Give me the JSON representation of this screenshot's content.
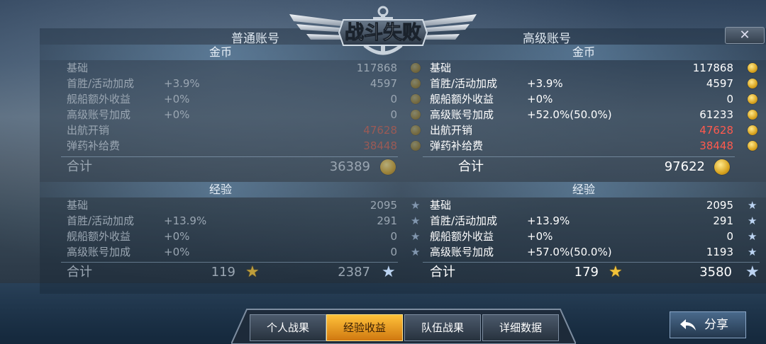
{
  "banner": {
    "title": "战斗失败"
  },
  "close_label": "✕",
  "normal": {
    "title": "普通账号",
    "gold": {
      "header": "金币",
      "rows": [
        {
          "label": "基础",
          "pct": "",
          "value": "117868"
        },
        {
          "label": "首胜/活动加成",
          "pct": "+3.9%",
          "value": "4597"
        },
        {
          "label": "舰船额外收益",
          "pct": "+0%",
          "value": "0"
        },
        {
          "label": "高级账号加成",
          "pct": "+0%",
          "value": "0"
        },
        {
          "label": "出航开销",
          "pct": "",
          "value": "47628"
        },
        {
          "label": "弹药补给费",
          "pct": "",
          "value": "38448"
        }
      ],
      "total_label": "合计",
      "total": "36389"
    },
    "exp": {
      "header": "经验",
      "rows": [
        {
          "label": "基础",
          "pct": "",
          "value": "2095"
        },
        {
          "label": "首胜/活动加成",
          "pct": "+13.9%",
          "value": "291"
        },
        {
          "label": "舰船额外收益",
          "pct": "+0%",
          "value": "0"
        },
        {
          "label": "高级账号加成",
          "pct": "+0%",
          "value": "0"
        }
      ],
      "total_label": "合计",
      "captain": "119",
      "total": "2387"
    }
  },
  "premium": {
    "title": "高级账号",
    "gold": {
      "header": "金币",
      "rows": [
        {
          "label": "基础",
          "pct": "",
          "value": "117868"
        },
        {
          "label": "首胜/活动加成",
          "pct": "+3.9%",
          "value": "4597"
        },
        {
          "label": "舰船额外收益",
          "pct": "+0%",
          "value": "0"
        },
        {
          "label": "高级账号加成",
          "pct": "+52.0%(50.0%)",
          "value": "61233"
        },
        {
          "label": "出航开销",
          "pct": "",
          "value": "47628"
        },
        {
          "label": "弹药补给费",
          "pct": "",
          "value": "38448"
        }
      ],
      "total_label": "合计",
      "total": "97622"
    },
    "exp": {
      "header": "经验",
      "rows": [
        {
          "label": "基础",
          "pct": "",
          "value": "2095"
        },
        {
          "label": "首胜/活动加成",
          "pct": "+13.9%",
          "value": "291"
        },
        {
          "label": "舰船额外收益",
          "pct": "+0%",
          "value": "0"
        },
        {
          "label": "高级账号加成",
          "pct": "+57.0%(50.0%)",
          "value": "1193"
        }
      ],
      "total_label": "合计",
      "captain": "179",
      "total": "3580"
    }
  },
  "colors": {
    "negative": "#ff5a4e",
    "active_tab": "#ffc23a",
    "coin": "#d8a420"
  },
  "icons": {
    "coin": "gold-coin-icon",
    "star": "star-icon",
    "share": "back-arrow-icon"
  },
  "tabs": [
    {
      "label": "个人战果",
      "active": false
    },
    {
      "label": "经验收益",
      "active": true
    },
    {
      "label": "队伍战果",
      "active": false
    },
    {
      "label": "详细数据",
      "active": false
    }
  ],
  "share_label": "分享"
}
